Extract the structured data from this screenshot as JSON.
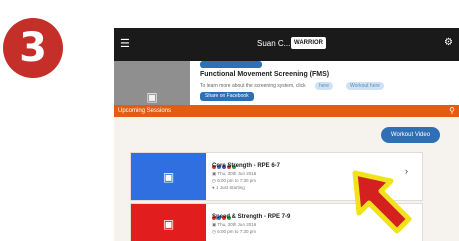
{
  "step": {
    "number": "3"
  },
  "topbar": {
    "menu_icon": "hamburger-menu-icon",
    "title": "Suan C...",
    "badge": "WARRIOR",
    "settings_icon": "gear-icon"
  },
  "post": {
    "title": "Functional Movement Screening (FMS)",
    "description": "To learn more about the screening system, click",
    "chip_one": "here",
    "chip_two": "Workout here",
    "share_button": "Share on Facebook"
  },
  "upcoming": {
    "label": "Upcoming Sessions",
    "search_icon": "search-icon"
  },
  "workout_video_button": "Workout Video",
  "sessions": [
    {
      "title": "Core Strength - RPE 6-7",
      "date": "Thu, 30th Jun 2016",
      "time": "6:00 pm to 7:30 pm",
      "attendees": "1 Just Starting",
      "image_color": "#2f6fe0"
    },
    {
      "title": "Speed & Strength - RPE 7-9",
      "date": "Thu, 30th Jun 2016",
      "time": "6:00 pm to 7:30 pm",
      "image_color": "#e11d1d"
    }
  ],
  "colors": {
    "step_badge": "#c42f29",
    "topbar": "#1a1a1a",
    "accent_orange": "#e65a14",
    "button_blue": "#2f6fb6",
    "arrow_red": "#d52020",
    "arrow_outline": "#f2e21a"
  }
}
